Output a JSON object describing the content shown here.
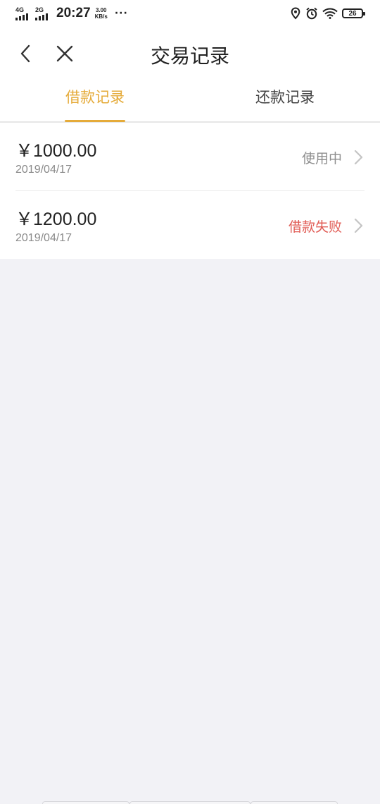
{
  "status_bar": {
    "signal1": "4G",
    "signal2": "2G",
    "time": "20:27",
    "speed_value": "3.00",
    "speed_unit": "KB/s",
    "more": "···",
    "battery": "26"
  },
  "nav": {
    "title": "交易记录",
    "back_icon": "chevron-left-icon",
    "close_icon": "close-icon"
  },
  "tabs": [
    {
      "label": "借款记录",
      "active": true
    },
    {
      "label": "还款记录",
      "active": false
    }
  ],
  "records": [
    {
      "amount": "￥1000.00",
      "date": "2019/04/17",
      "status": "使用中",
      "status_color": "#8e8e8e"
    },
    {
      "amount": "￥1200.00",
      "date": "2019/04/17",
      "status": "借款失败",
      "status_color": "#e15c55"
    }
  ],
  "colors": {
    "accent": "#e5ab3a",
    "failed": "#e15c55",
    "background": "#f2f2f6"
  }
}
